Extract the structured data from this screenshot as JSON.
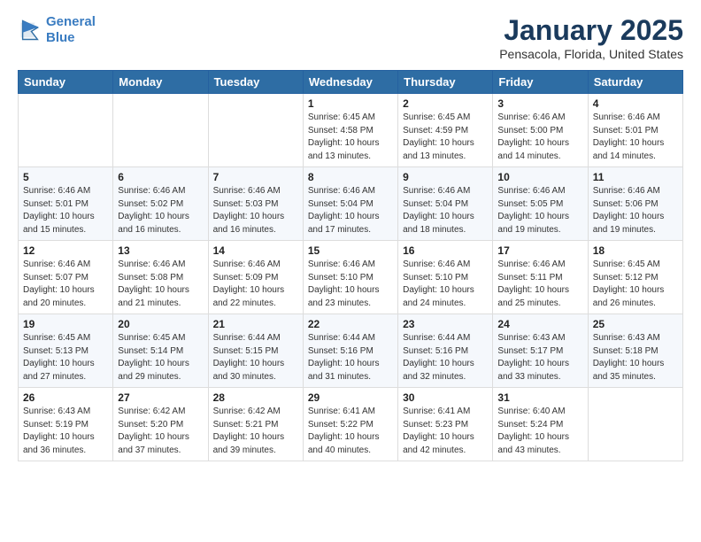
{
  "logo": {
    "line1": "General",
    "line2": "Blue"
  },
  "title": "January 2025",
  "subtitle": "Pensacola, Florida, United States",
  "days_of_week": [
    "Sunday",
    "Monday",
    "Tuesday",
    "Wednesday",
    "Thursday",
    "Friday",
    "Saturday"
  ],
  "weeks": [
    [
      {
        "day": "",
        "info": ""
      },
      {
        "day": "",
        "info": ""
      },
      {
        "day": "",
        "info": ""
      },
      {
        "day": "1",
        "info": "Sunrise: 6:45 AM\nSunset: 4:58 PM\nDaylight: 10 hours\nand 13 minutes."
      },
      {
        "day": "2",
        "info": "Sunrise: 6:45 AM\nSunset: 4:59 PM\nDaylight: 10 hours\nand 13 minutes."
      },
      {
        "day": "3",
        "info": "Sunrise: 6:46 AM\nSunset: 5:00 PM\nDaylight: 10 hours\nand 14 minutes."
      },
      {
        "day": "4",
        "info": "Sunrise: 6:46 AM\nSunset: 5:01 PM\nDaylight: 10 hours\nand 14 minutes."
      }
    ],
    [
      {
        "day": "5",
        "info": "Sunrise: 6:46 AM\nSunset: 5:01 PM\nDaylight: 10 hours\nand 15 minutes."
      },
      {
        "day": "6",
        "info": "Sunrise: 6:46 AM\nSunset: 5:02 PM\nDaylight: 10 hours\nand 16 minutes."
      },
      {
        "day": "7",
        "info": "Sunrise: 6:46 AM\nSunset: 5:03 PM\nDaylight: 10 hours\nand 16 minutes."
      },
      {
        "day": "8",
        "info": "Sunrise: 6:46 AM\nSunset: 5:04 PM\nDaylight: 10 hours\nand 17 minutes."
      },
      {
        "day": "9",
        "info": "Sunrise: 6:46 AM\nSunset: 5:04 PM\nDaylight: 10 hours\nand 18 minutes."
      },
      {
        "day": "10",
        "info": "Sunrise: 6:46 AM\nSunset: 5:05 PM\nDaylight: 10 hours\nand 19 minutes."
      },
      {
        "day": "11",
        "info": "Sunrise: 6:46 AM\nSunset: 5:06 PM\nDaylight: 10 hours\nand 19 minutes."
      }
    ],
    [
      {
        "day": "12",
        "info": "Sunrise: 6:46 AM\nSunset: 5:07 PM\nDaylight: 10 hours\nand 20 minutes."
      },
      {
        "day": "13",
        "info": "Sunrise: 6:46 AM\nSunset: 5:08 PM\nDaylight: 10 hours\nand 21 minutes."
      },
      {
        "day": "14",
        "info": "Sunrise: 6:46 AM\nSunset: 5:09 PM\nDaylight: 10 hours\nand 22 minutes."
      },
      {
        "day": "15",
        "info": "Sunrise: 6:46 AM\nSunset: 5:10 PM\nDaylight: 10 hours\nand 23 minutes."
      },
      {
        "day": "16",
        "info": "Sunrise: 6:46 AM\nSunset: 5:10 PM\nDaylight: 10 hours\nand 24 minutes."
      },
      {
        "day": "17",
        "info": "Sunrise: 6:46 AM\nSunset: 5:11 PM\nDaylight: 10 hours\nand 25 minutes."
      },
      {
        "day": "18",
        "info": "Sunrise: 6:45 AM\nSunset: 5:12 PM\nDaylight: 10 hours\nand 26 minutes."
      }
    ],
    [
      {
        "day": "19",
        "info": "Sunrise: 6:45 AM\nSunset: 5:13 PM\nDaylight: 10 hours\nand 27 minutes."
      },
      {
        "day": "20",
        "info": "Sunrise: 6:45 AM\nSunset: 5:14 PM\nDaylight: 10 hours\nand 29 minutes."
      },
      {
        "day": "21",
        "info": "Sunrise: 6:44 AM\nSunset: 5:15 PM\nDaylight: 10 hours\nand 30 minutes."
      },
      {
        "day": "22",
        "info": "Sunrise: 6:44 AM\nSunset: 5:16 PM\nDaylight: 10 hours\nand 31 minutes."
      },
      {
        "day": "23",
        "info": "Sunrise: 6:44 AM\nSunset: 5:16 PM\nDaylight: 10 hours\nand 32 minutes."
      },
      {
        "day": "24",
        "info": "Sunrise: 6:43 AM\nSunset: 5:17 PM\nDaylight: 10 hours\nand 33 minutes."
      },
      {
        "day": "25",
        "info": "Sunrise: 6:43 AM\nSunset: 5:18 PM\nDaylight: 10 hours\nand 35 minutes."
      }
    ],
    [
      {
        "day": "26",
        "info": "Sunrise: 6:43 AM\nSunset: 5:19 PM\nDaylight: 10 hours\nand 36 minutes."
      },
      {
        "day": "27",
        "info": "Sunrise: 6:42 AM\nSunset: 5:20 PM\nDaylight: 10 hours\nand 37 minutes."
      },
      {
        "day": "28",
        "info": "Sunrise: 6:42 AM\nSunset: 5:21 PM\nDaylight: 10 hours\nand 39 minutes."
      },
      {
        "day": "29",
        "info": "Sunrise: 6:41 AM\nSunset: 5:22 PM\nDaylight: 10 hours\nand 40 minutes."
      },
      {
        "day": "30",
        "info": "Sunrise: 6:41 AM\nSunset: 5:23 PM\nDaylight: 10 hours\nand 42 minutes."
      },
      {
        "day": "31",
        "info": "Sunrise: 6:40 AM\nSunset: 5:24 PM\nDaylight: 10 hours\nand 43 minutes."
      },
      {
        "day": "",
        "info": ""
      }
    ]
  ]
}
